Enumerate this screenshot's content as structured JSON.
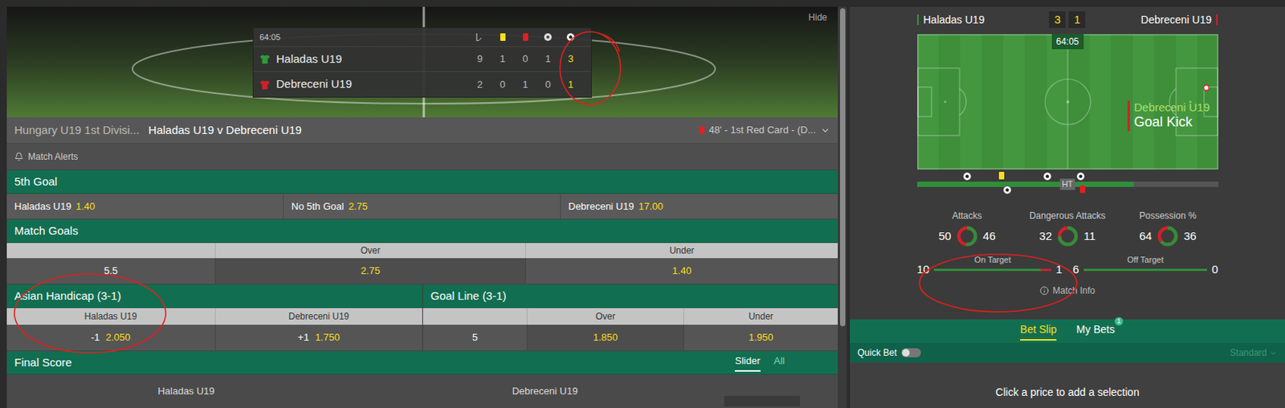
{
  "scoreboard": {
    "clock": "64:05",
    "hide": "Hide",
    "teams": [
      {
        "name": "Haladas U19",
        "color": "#2f9a3c",
        "stats": [
          "9",
          "1",
          "0",
          "1",
          "3"
        ]
      },
      {
        "name": "Debreceni U19",
        "color": "#d0202a",
        "stats": [
          "2",
          "0",
          "1",
          "0",
          "1"
        ]
      }
    ]
  },
  "match_header": {
    "league": "Hungary U19 1st Divisi...",
    "title": "Haladas U19 v Debreceni U19",
    "last_event": "48' - 1st Red Card - (D..."
  },
  "match_alerts": "Match Alerts",
  "fifth_goal": {
    "title": "5th Goal",
    "options": [
      {
        "label": "Haladas U19",
        "odds": "1.40"
      },
      {
        "label": "No 5th Goal",
        "odds": "2.75"
      },
      {
        "label": "Debreceni U19",
        "odds": "17.00"
      }
    ]
  },
  "match_goals": {
    "title": "Match Goals",
    "columns": [
      "Over",
      "Under"
    ],
    "rows": [
      {
        "line": "5.5",
        "over": "2.75",
        "under": "1.40"
      }
    ]
  },
  "asian_handicap": {
    "title": "Asian Handicap (3-1)",
    "columns": [
      "Haladas U19",
      "Debreceni U19"
    ],
    "rows": [
      {
        "cells": [
          {
            "line": "-1",
            "odds": "2.050"
          },
          {
            "line": "+1",
            "odds": "1.750"
          }
        ]
      }
    ]
  },
  "goal_line": {
    "title": "Goal Line (3-1)",
    "columns": [
      "Over",
      "Under"
    ],
    "rows": [
      {
        "line": "5",
        "over": "1.850",
        "under": "1.950"
      }
    ]
  },
  "final_score": {
    "title": "Final Score",
    "views": [
      {
        "label": "Slider",
        "selected": true
      },
      {
        "label": "All",
        "selected": false
      }
    ],
    "teams": [
      "Haladas U19",
      "Debreceni U19"
    ]
  },
  "tracker": {
    "home": {
      "name": "Haladas U19",
      "score": "3",
      "color": "#2f9a3c"
    },
    "away": {
      "name": "Debreceni U19",
      "score": "1",
      "color": "#d0202a"
    },
    "clock": "64:05",
    "event": {
      "team": "Debreceni U19",
      "action": "Goal Kick"
    },
    "timeline": {
      "level": 0.72,
      "half_label": "HT",
      "events": [
        {
          "kind": "goal",
          "team": "home",
          "minute": 15
        },
        {
          "kind": "yellow",
          "team": "home",
          "minute": 26
        },
        {
          "kind": "goal",
          "team": "away",
          "minute": 27
        },
        {
          "kind": "goal",
          "team": "home",
          "minute": 39
        },
        {
          "kind": "goal",
          "team": "home",
          "minute": 49
        },
        {
          "kind": "red",
          "team": "away",
          "minute": 50
        }
      ]
    },
    "stats": [
      {
        "label": "Attacks",
        "home": "50",
        "away": "46",
        "level": 0.52
      },
      {
        "label": "Dangerous Attacks",
        "home": "32",
        "away": "11",
        "level": 0.74
      },
      {
        "label": "Possession %",
        "home": "64",
        "away": "36",
        "level": 0.64
      }
    ],
    "bars": [
      {
        "label": "On Target",
        "home": "10",
        "away": "1",
        "level": 0.91
      },
      {
        "label": "Off Target",
        "home": "6",
        "away": "0",
        "level": 1
      }
    ],
    "match_info": "Match Info"
  },
  "bet_slip": {
    "tabs": [
      {
        "label": "Bet Slip",
        "selected": true
      },
      {
        "label": "My Bets",
        "selected": false,
        "badge": "1"
      }
    ],
    "quick_bet": {
      "label": "Quick Bet",
      "on": false
    },
    "mode": "Standard",
    "empty": "Click a price to add a selection"
  }
}
